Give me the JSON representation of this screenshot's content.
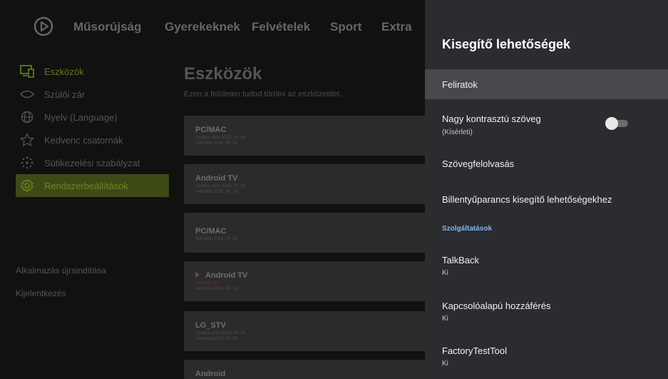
{
  "nav": {
    "items": [
      "Műsorújság",
      "Gyerekeknek",
      "Felvételek",
      "Sport",
      "Extra"
    ]
  },
  "sidebar": {
    "items": [
      {
        "label": "Eszközök",
        "icon": "devices-icon"
      },
      {
        "label": "Szülői zár",
        "icon": "parental-lock-icon"
      },
      {
        "label": "Nyelv (Language)",
        "icon": "globe-icon"
      },
      {
        "label": "Kedvenc csatornák",
        "icon": "star-icon"
      },
      {
        "label": "Sütikezelési szabályzat",
        "icon": "cookie-icon"
      },
      {
        "label": "Rendszerbeállítások",
        "icon": "gear-icon"
      }
    ],
    "restart_label": "Alkalmazás újraindítása",
    "logout_label": "Kijelentkezés"
  },
  "main": {
    "title": "Eszközök",
    "subtitle": "Ezen a felületen tudod törölni az eszközeidet.",
    "devices": [
      {
        "name": "PC/MAC",
        "line1": "Utoljára aktív 2025. 10. 06.",
        "line2": "Aktiválva 2025. 09. 25."
      },
      {
        "name": "Android TV",
        "line1": "Utoljára aktív 2025. 09. 24.",
        "line2": "Aktiválva 2025. 09. 24."
      },
      {
        "name": "PC/MAC",
        "line1": "Aktiválva 2025. 05. 02.",
        "line2": ""
      },
      {
        "name": "Android TV",
        "line1": "Jelenleg aktív",
        "line2": "Aktiválva 2025. 08. 11."
      },
      {
        "name": "LG_STV",
        "line1": "Utoljára aktív 2025. 09. 24.",
        "line2": "Aktiválva 2025. 06. 05."
      },
      {
        "name": "Android",
        "line1": "",
        "line2": ""
      }
    ]
  },
  "panel": {
    "title": "Kisegítő lehetőségek",
    "items": [
      {
        "label": "Feliratok",
        "sub": ""
      },
      {
        "label": "Nagy kontrasztú szöveg",
        "sub": "(Kísérleti)"
      },
      {
        "label": "Szövegfelolvasás",
        "sub": ""
      },
      {
        "label": "Billentyűparancs kisegítő lehetőségekhez",
        "sub": ""
      },
      {
        "label": "TalkBack",
        "sub": "Ki"
      },
      {
        "label": "Kapcsolóalapú hozzáférés",
        "sub": "Ki"
      },
      {
        "label": "FactoryTestTool",
        "sub": "Ki"
      }
    ],
    "section_label": "Szolgáltatások",
    "high_contrast_on": false
  },
  "colors": {
    "accent_green": "#6c8520",
    "section_blue": "#7fb4f5",
    "panel_bg": "#2b2c2f"
  }
}
